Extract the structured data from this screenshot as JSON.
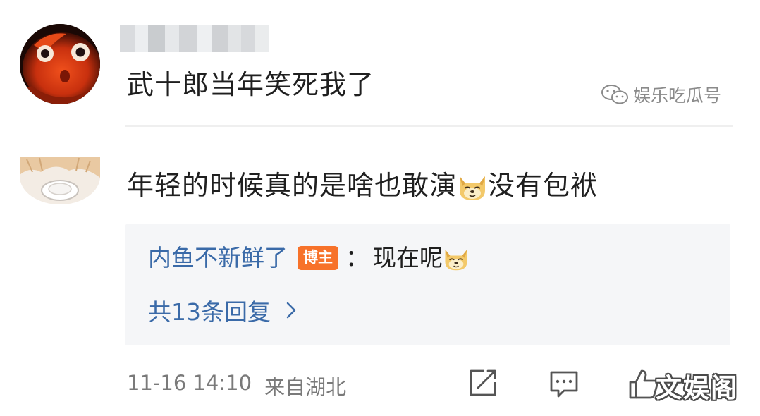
{
  "comments": [
    {
      "author": "",
      "text": "武十郎当年笑死我了",
      "watermark": "娱乐吃瓜号",
      "avatar_icon": "goldfish-avatar"
    },
    {
      "text_before": "年轻的时候真的是啥也敢演",
      "text_after": "没有包袱",
      "emoji_icon": "doge-emoji",
      "avatar_icon": "cartoon-avatar",
      "reply": {
        "user": "内鱼不新鲜了",
        "badge": "博主",
        "colon": "：",
        "body": "现在呢",
        "emoji_icon": "doge-emoji",
        "count_text": "共13条回复",
        "chevron": "›"
      }
    }
  ],
  "footer": {
    "date": "11-16 14:10",
    "location": "来自湖北",
    "actions": [
      "share-icon",
      "comment-icon",
      "like-icon"
    ],
    "corner_watermark": "文娱阁"
  },
  "colors": {
    "link_blue": "#3a6aa8",
    "badge_orange": "#f7722a",
    "meta_gray": "#7a7a7a",
    "reply_bg": "#f5f6f8"
  }
}
